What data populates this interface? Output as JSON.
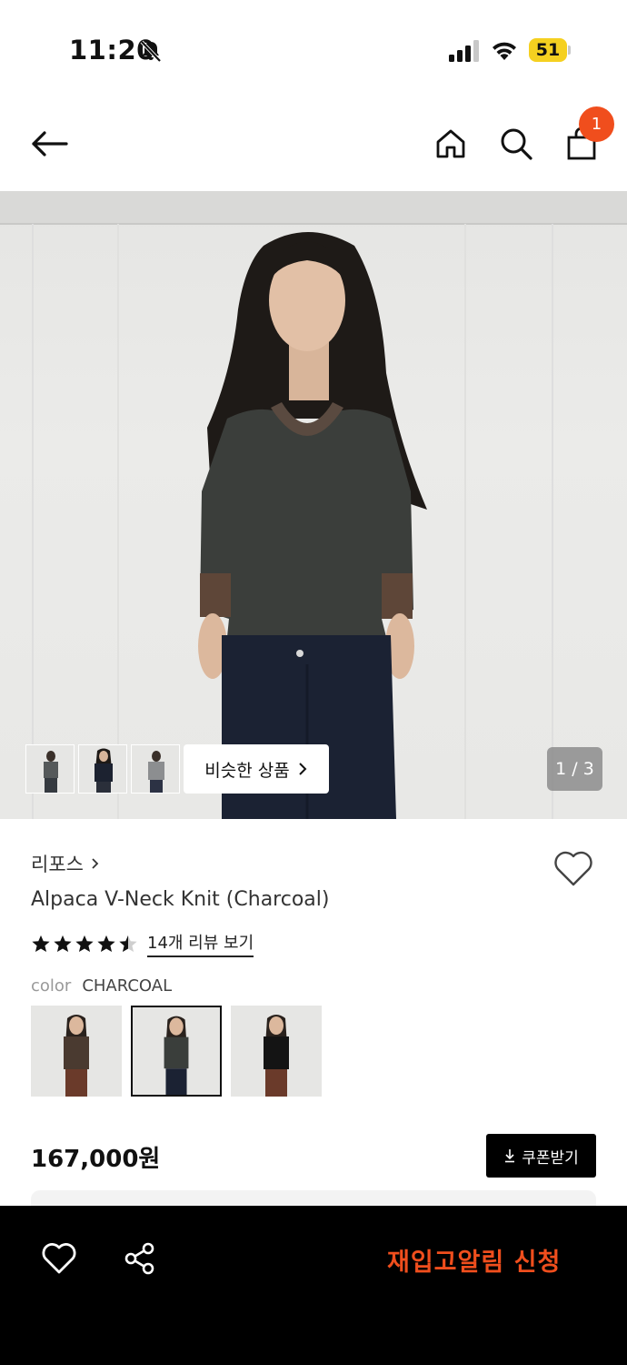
{
  "status_bar": {
    "time": "11:20",
    "battery": "51"
  },
  "header": {
    "cart_count": "1",
    "icons": [
      "back-arrow-icon",
      "home-icon",
      "search-icon",
      "shopping-bag-icon"
    ]
  },
  "gallery": {
    "similar_label": "비슷한 상품",
    "pager": "1 / 3",
    "thumbnails": 3
  },
  "product": {
    "brand": "리포스",
    "name": "Alpaca V-Neck Knit (Charcoal)",
    "rating": 4.5,
    "review_link": "14개 리뷰 보기",
    "color_label": "color",
    "color_value": "CHARCOAL",
    "price": "167,000원",
    "coupon_label": "쿠폰받기"
  },
  "bottom_bar": {
    "restock_label": "재입고알림 신청"
  },
  "colors": {
    "accent": "#f04e1d",
    "restock_text": "#f04e1d",
    "badge": "#f04e1d",
    "battery": "#f5d020"
  }
}
